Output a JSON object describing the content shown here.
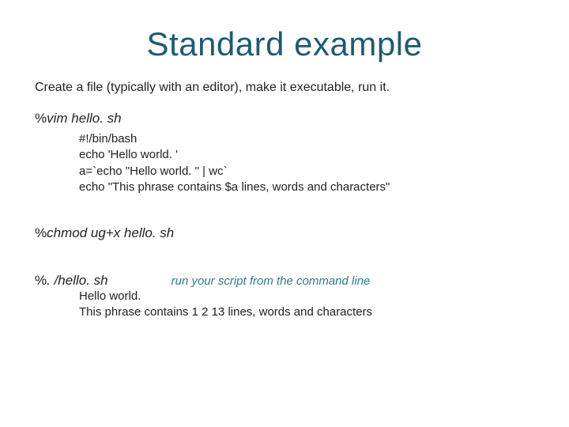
{
  "title": "Standard example",
  "intro": "Create a file (typically with an editor), make it executable, run it.",
  "cmd1": {
    "prefix": "%",
    "text": "vim hello. sh"
  },
  "script_lines": "#!/bin/bash\necho 'Hello world. '\na=`echo \"Hello world. \" | wc`\necho \"This phrase contains $a lines, words and characters\"",
  "cmd2": {
    "prefix": "%",
    "text": "chmod ug+x hello. sh"
  },
  "cmd3": {
    "prefix": "%",
    "text": ". /hello. sh"
  },
  "run_note": "run your script from the command line",
  "output_lines": "Hello world.\nThis phrase contains 1 2 13 lines, words and characters"
}
